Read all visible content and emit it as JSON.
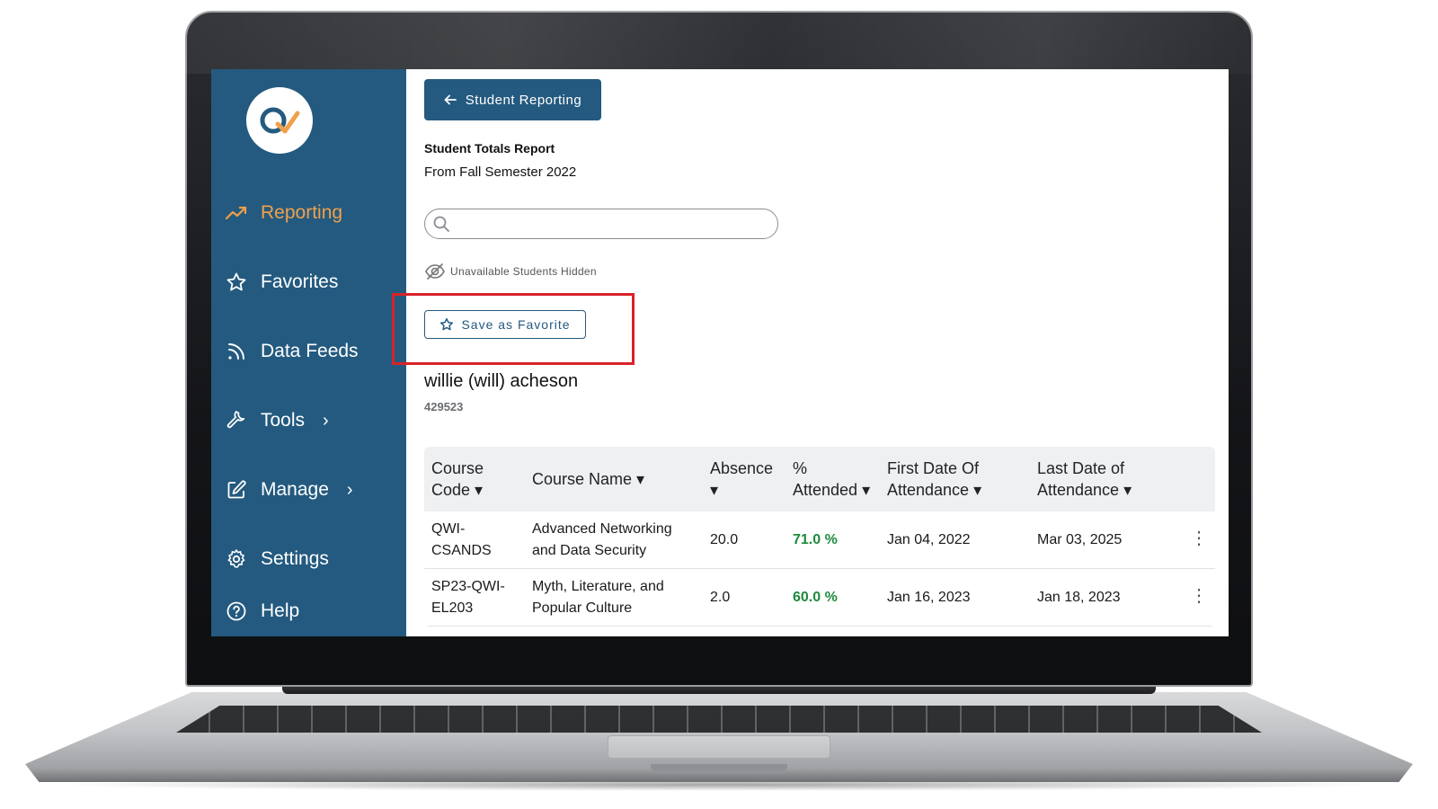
{
  "sidebar": {
    "items": [
      {
        "label": "Reporting",
        "icon": "trend-up-icon"
      },
      {
        "label": "Favorites",
        "icon": "star-icon"
      },
      {
        "label": "Data Feeds",
        "icon": "rss-icon"
      },
      {
        "label": "Tools",
        "icon": "wrench-icon",
        "chevron": "›"
      },
      {
        "label": "Manage",
        "icon": "edit-icon",
        "chevron": "›"
      },
      {
        "label": "Settings",
        "icon": "gear-icon"
      },
      {
        "label": "Help",
        "icon": "help-icon"
      }
    ],
    "active": "Reporting"
  },
  "header": {
    "back_label": "Student Reporting",
    "report_title": "Student Totals Report",
    "report_subtitle": "From Fall Semester 2022"
  },
  "search": {
    "value": "",
    "placeholder": ""
  },
  "filter_label": "Unavailable Students Hidden",
  "favorite_label": "Save as Favorite",
  "student": {
    "name": "willie (will) acheson",
    "id": "429523"
  },
  "table": {
    "headers": [
      {
        "line1": "Course",
        "line2": "Code ▾"
      },
      {
        "line1": "Course Name ▾",
        "line2": ""
      },
      {
        "line1": "Absence",
        "line2": "▾"
      },
      {
        "line1": "%",
        "line2": "Attended ▾"
      },
      {
        "line1": "First Date Of",
        "line2": "Attendance ▾"
      },
      {
        "line1": "Last Date of",
        "line2": "Attendance ▾"
      }
    ],
    "rows": [
      {
        "code1": "QWI-",
        "code2": "CSANDS",
        "name1": "Advanced Networking",
        "name2": "and Data Security",
        "absence": "20.0",
        "attended": "71.0 %",
        "first": "Jan 04, 2022",
        "last": "Mar 03, 2025"
      },
      {
        "code1": "SP23-QWI-",
        "code2": "EL203",
        "name1": "Myth, Literature, and",
        "name2": "Popular Culture",
        "absence": "2.0",
        "attended": "60.0 %",
        "first": "Jan 16, 2023",
        "last": "Jan 18, 2023"
      }
    ]
  },
  "colors": {
    "sidebar": "#245a7f",
    "active": "#f0a04b",
    "highlight": "#d8232a",
    "attended": "#1e8a3c"
  }
}
